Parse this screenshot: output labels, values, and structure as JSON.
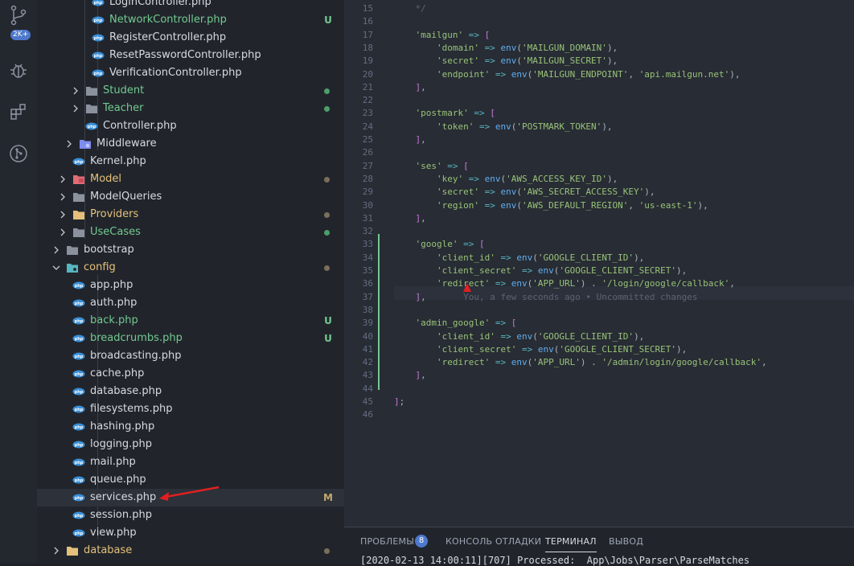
{
  "activity_bar": {
    "source_control_badge": "2K+"
  },
  "explorer": {
    "rows": [
      {
        "label": "LoginController.php",
        "kind": "php",
        "color": "#d7dae0",
        "status": ""
      },
      {
        "label": "NetworkController.php",
        "kind": "php",
        "color": "#73c991",
        "status": "U"
      },
      {
        "label": "RegisterController.php",
        "kind": "php",
        "color": "#d7dae0",
        "status": ""
      },
      {
        "label": "ResetPasswordController.php",
        "kind": "php",
        "color": "#d7dae0",
        "status": ""
      },
      {
        "label": "VerificationController.php",
        "kind": "php",
        "color": "#d7dae0",
        "status": ""
      },
      {
        "label": "Student",
        "kind": "folder",
        "color": "#73c991",
        "status": "dot-green"
      },
      {
        "label": "Teacher",
        "kind": "folder",
        "color": "#73c991",
        "status": "dot-green"
      },
      {
        "label": "Controller.php",
        "kind": "php",
        "color": "#d7dae0",
        "status": ""
      },
      {
        "label": "Middleware",
        "kind": "folder-special",
        "color": "#d7dae0",
        "status": ""
      },
      {
        "label": "Kernel.php",
        "kind": "php",
        "color": "#d7dae0",
        "status": ""
      },
      {
        "label": "Model",
        "kind": "folder-red",
        "color": "#e5c07b",
        "status": "dot-grey"
      },
      {
        "label": "ModelQueries",
        "kind": "folder",
        "color": "#d7dae0",
        "status": ""
      },
      {
        "label": "Providers",
        "kind": "folder-yellow",
        "color": "#e5c07b",
        "status": "dot-grey"
      },
      {
        "label": "UseCases",
        "kind": "folder",
        "color": "#73c991",
        "status": "dot-green"
      },
      {
        "label": "bootstrap",
        "kind": "folder",
        "color": "#d7dae0",
        "status": ""
      },
      {
        "label": "config",
        "kind": "folder-config",
        "color": "#e5c07b",
        "status": "dot-grey"
      },
      {
        "label": "app.php",
        "kind": "php",
        "color": "#d7dae0",
        "status": ""
      },
      {
        "label": "auth.php",
        "kind": "php",
        "color": "#d7dae0",
        "status": ""
      },
      {
        "label": "back.php",
        "kind": "php",
        "color": "#73c991",
        "status": "U"
      },
      {
        "label": "breadcrumbs.php",
        "kind": "php",
        "color": "#73c991",
        "status": "U"
      },
      {
        "label": "broadcasting.php",
        "kind": "php",
        "color": "#d7dae0",
        "status": ""
      },
      {
        "label": "cache.php",
        "kind": "php",
        "color": "#d7dae0",
        "status": ""
      },
      {
        "label": "database.php",
        "kind": "php",
        "color": "#d7dae0",
        "status": ""
      },
      {
        "label": "filesystems.php",
        "kind": "php",
        "color": "#d7dae0",
        "status": ""
      },
      {
        "label": "hashing.php",
        "kind": "php",
        "color": "#d7dae0",
        "status": ""
      },
      {
        "label": "logging.php",
        "kind": "php",
        "color": "#d7dae0",
        "status": ""
      },
      {
        "label": "mail.php",
        "kind": "php",
        "color": "#d7dae0",
        "status": ""
      },
      {
        "label": "queue.php",
        "kind": "php",
        "color": "#d7dae0",
        "status": ""
      },
      {
        "label": "services.php",
        "kind": "php",
        "color": "#d7dae0",
        "status": "M"
      },
      {
        "label": "session.php",
        "kind": "php",
        "color": "#d7dae0",
        "status": ""
      },
      {
        "label": "view.php",
        "kind": "php",
        "color": "#d7dae0",
        "status": ""
      },
      {
        "label": "database",
        "kind": "folder-yellow",
        "color": "#e5c07b",
        "status": "dot-grey"
      }
    ]
  },
  "editor": {
    "line_numbers": [
      "15",
      "16",
      "17",
      "18",
      "19",
      "20",
      "21",
      "22",
      "23",
      "24",
      "25",
      "26",
      "27",
      "28",
      "29",
      "30",
      "31",
      "32",
      "33",
      "34",
      "35",
      "36",
      "37",
      "38",
      "39",
      "40",
      "41",
      "42",
      "43",
      "44",
      "45",
      "46"
    ],
    "blame": "You, a few seconds ago • Uncommitted changes",
    "lines": [
      [
        {
          "t": "    */",
          "c": "c"
        }
      ],
      [],
      [
        {
          "t": "    ",
          "c": "b"
        },
        {
          "t": "'mailgun'",
          "c": "k"
        },
        {
          "t": " => ",
          "c": "o"
        },
        {
          "t": "[",
          "c": "p"
        }
      ],
      [
        {
          "t": "        ",
          "c": "b"
        },
        {
          "t": "'domain'",
          "c": "k"
        },
        {
          "t": " => ",
          "c": "o"
        },
        {
          "t": "env",
          "c": "f"
        },
        {
          "t": "(",
          "c": "b"
        },
        {
          "t": "'MAILGUN_DOMAIN'",
          "c": "k"
        },
        {
          "t": "),",
          "c": "b"
        }
      ],
      [
        {
          "t": "        ",
          "c": "b"
        },
        {
          "t": "'secret'",
          "c": "k"
        },
        {
          "t": " => ",
          "c": "o"
        },
        {
          "t": "env",
          "c": "f"
        },
        {
          "t": "(",
          "c": "b"
        },
        {
          "t": "'MAILGUN_SECRET'",
          "c": "k"
        },
        {
          "t": "),",
          "c": "b"
        }
      ],
      [
        {
          "t": "        ",
          "c": "b"
        },
        {
          "t": "'endpoint'",
          "c": "k"
        },
        {
          "t": " => ",
          "c": "o"
        },
        {
          "t": "env",
          "c": "f"
        },
        {
          "t": "(",
          "c": "b"
        },
        {
          "t": "'MAILGUN_ENDPOINT'",
          "c": "k"
        },
        {
          "t": ", ",
          "c": "b"
        },
        {
          "t": "'api.mailgun.net'",
          "c": "k"
        },
        {
          "t": "),",
          "c": "b"
        }
      ],
      [
        {
          "t": "    ",
          "c": "b"
        },
        {
          "t": "]",
          "c": "p"
        },
        {
          "t": ",",
          "c": "b"
        }
      ],
      [],
      [
        {
          "t": "    ",
          "c": "b"
        },
        {
          "t": "'postmark'",
          "c": "k"
        },
        {
          "t": " => ",
          "c": "o"
        },
        {
          "t": "[",
          "c": "p"
        }
      ],
      [
        {
          "t": "        ",
          "c": "b"
        },
        {
          "t": "'token'",
          "c": "k"
        },
        {
          "t": " => ",
          "c": "o"
        },
        {
          "t": "env",
          "c": "f"
        },
        {
          "t": "(",
          "c": "b"
        },
        {
          "t": "'POSTMARK_TOKEN'",
          "c": "k"
        },
        {
          "t": "),",
          "c": "b"
        }
      ],
      [
        {
          "t": "    ",
          "c": "b"
        },
        {
          "t": "]",
          "c": "p"
        },
        {
          "t": ",",
          "c": "b"
        }
      ],
      [],
      [
        {
          "t": "    ",
          "c": "b"
        },
        {
          "t": "'ses'",
          "c": "k"
        },
        {
          "t": " => ",
          "c": "o"
        },
        {
          "t": "[",
          "c": "p"
        }
      ],
      [
        {
          "t": "        ",
          "c": "b"
        },
        {
          "t": "'key'",
          "c": "k"
        },
        {
          "t": " => ",
          "c": "o"
        },
        {
          "t": "env",
          "c": "f"
        },
        {
          "t": "(",
          "c": "b"
        },
        {
          "t": "'AWS_ACCESS_KEY_ID'",
          "c": "k"
        },
        {
          "t": "),",
          "c": "b"
        }
      ],
      [
        {
          "t": "        ",
          "c": "b"
        },
        {
          "t": "'secret'",
          "c": "k"
        },
        {
          "t": " => ",
          "c": "o"
        },
        {
          "t": "env",
          "c": "f"
        },
        {
          "t": "(",
          "c": "b"
        },
        {
          "t": "'AWS_SECRET_ACCESS_KEY'",
          "c": "k"
        },
        {
          "t": "),",
          "c": "b"
        }
      ],
      [
        {
          "t": "        ",
          "c": "b"
        },
        {
          "t": "'region'",
          "c": "k"
        },
        {
          "t": " => ",
          "c": "o"
        },
        {
          "t": "env",
          "c": "f"
        },
        {
          "t": "(",
          "c": "b"
        },
        {
          "t": "'AWS_DEFAULT_REGION'",
          "c": "k"
        },
        {
          "t": ", ",
          "c": "b"
        },
        {
          "t": "'us-east-1'",
          "c": "k"
        },
        {
          "t": "),",
          "c": "b"
        }
      ],
      [
        {
          "t": "    ",
          "c": "b"
        },
        {
          "t": "]",
          "c": "p"
        },
        {
          "t": ",",
          "c": "b"
        }
      ],
      [],
      [
        {
          "t": "    ",
          "c": "b"
        },
        {
          "t": "'google'",
          "c": "k"
        },
        {
          "t": " => ",
          "c": "o"
        },
        {
          "t": "[",
          "c": "p"
        }
      ],
      [
        {
          "t": "        ",
          "c": "b"
        },
        {
          "t": "'client_id'",
          "c": "k"
        },
        {
          "t": " => ",
          "c": "o"
        },
        {
          "t": "env",
          "c": "f"
        },
        {
          "t": "(",
          "c": "b"
        },
        {
          "t": "'GOOGLE_CLIENT_ID'",
          "c": "k"
        },
        {
          "t": "),",
          "c": "b"
        }
      ],
      [
        {
          "t": "        ",
          "c": "b"
        },
        {
          "t": "'client_secret'",
          "c": "k"
        },
        {
          "t": " => ",
          "c": "o"
        },
        {
          "t": "env",
          "c": "f"
        },
        {
          "t": "(",
          "c": "b"
        },
        {
          "t": "'GOOGLE_CLIENT_SECRET'",
          "c": "k"
        },
        {
          "t": "),",
          "c": "b"
        }
      ],
      [
        {
          "t": "        ",
          "c": "b"
        },
        {
          "t": "'redirect'",
          "c": "k"
        },
        {
          "t": " => ",
          "c": "o"
        },
        {
          "t": "env",
          "c": "f"
        },
        {
          "t": "(",
          "c": "b"
        },
        {
          "t": "'APP_URL'",
          "c": "k"
        },
        {
          "t": ") . ",
          "c": "b"
        },
        {
          "t": "'/login/google/callback'",
          "c": "k"
        },
        {
          "t": ",",
          "c": "b"
        }
      ],
      [
        {
          "t": "    ",
          "c": "b"
        },
        {
          "t": "]",
          "c": "p"
        },
        {
          "t": ",",
          "c": "b"
        },
        {
          "t": "       ",
          "c": "b"
        },
        {
          "t": "@BLAME",
          "c": "blame"
        }
      ],
      [],
      [
        {
          "t": "    ",
          "c": "b"
        },
        {
          "t": "'admin_google'",
          "c": "k"
        },
        {
          "t": " => ",
          "c": "o"
        },
        {
          "t": "[",
          "c": "p"
        }
      ],
      [
        {
          "t": "        ",
          "c": "b"
        },
        {
          "t": "'client_id'",
          "c": "k"
        },
        {
          "t": " => ",
          "c": "o"
        },
        {
          "t": "env",
          "c": "f"
        },
        {
          "t": "(",
          "c": "b"
        },
        {
          "t": "'GOOGLE_CLIENT_ID'",
          "c": "k"
        },
        {
          "t": "),",
          "c": "b"
        }
      ],
      [
        {
          "t": "        ",
          "c": "b"
        },
        {
          "t": "'client_secret'",
          "c": "k"
        },
        {
          "t": " => ",
          "c": "o"
        },
        {
          "t": "env",
          "c": "f"
        },
        {
          "t": "(",
          "c": "b"
        },
        {
          "t": "'GOOGLE_CLIENT_SECRET'",
          "c": "k"
        },
        {
          "t": "),",
          "c": "b"
        }
      ],
      [
        {
          "t": "        ",
          "c": "b"
        },
        {
          "t": "'redirect'",
          "c": "k"
        },
        {
          "t": " => ",
          "c": "o"
        },
        {
          "t": "env",
          "c": "f"
        },
        {
          "t": "(",
          "c": "b"
        },
        {
          "t": "'APP_URL'",
          "c": "k"
        },
        {
          "t": ") . ",
          "c": "b"
        },
        {
          "t": "'/admin/login/google/callback'",
          "c": "k"
        },
        {
          "t": ",",
          "c": "b"
        }
      ],
      [
        {
          "t": "    ",
          "c": "b"
        },
        {
          "t": "]",
          "c": "p"
        },
        {
          "t": ",",
          "c": "b"
        }
      ],
      [],
      [
        {
          "t": "]",
          "c": "p"
        },
        {
          "t": ";",
          "c": "b"
        }
      ],
      []
    ]
  },
  "panel": {
    "tabs": [
      {
        "label": "ПРОБЛЕМЫ"
      },
      {
        "label": "КОНСОЛЬ ОТЛАДКИ"
      },
      {
        "label": "ТЕРМИНАЛ"
      },
      {
        "label": "ВЫВОД"
      }
    ],
    "problems_count": "8",
    "terminal_text": "[2020-02-13 14:00:11][707] Processed:  App\\Jobs\\Parser\\ParseMatches"
  },
  "colors": {
    "git_added": "#73c991",
    "accent": "#4d78cc",
    "annotation_arrow": "#e02020"
  }
}
